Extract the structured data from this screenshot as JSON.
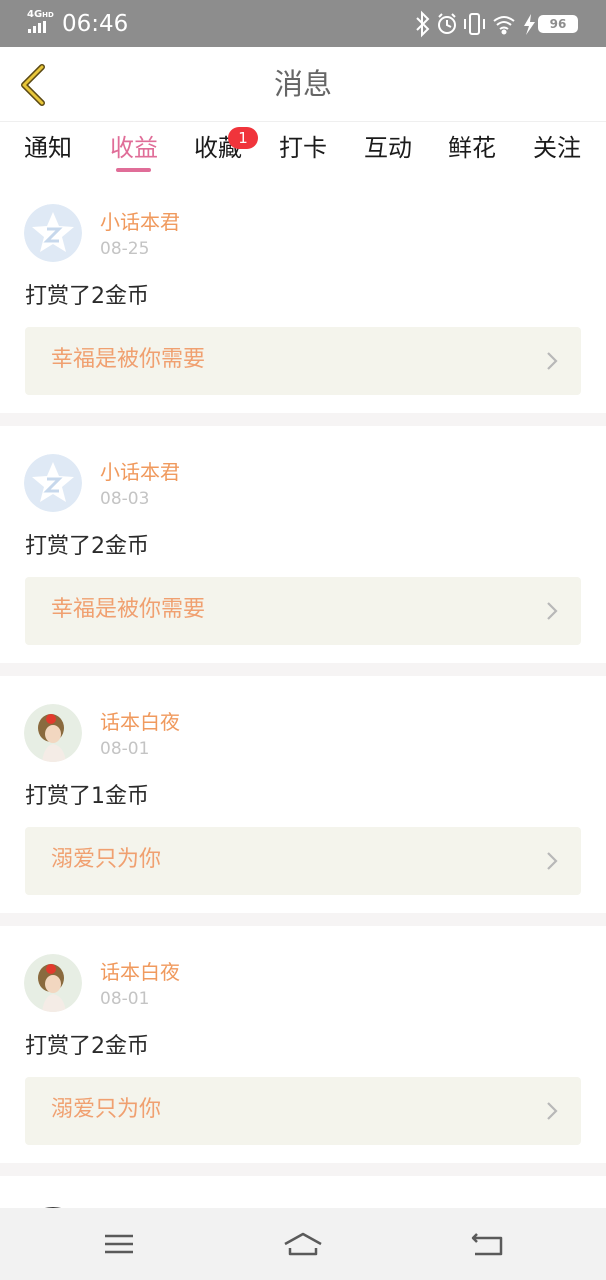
{
  "status_bar": {
    "network": "4G",
    "network_sup": "HD",
    "time": "06:46",
    "battery": "96",
    "icons": [
      "bluetooth-icon",
      "alarm-icon",
      "vibrate-icon",
      "wifi-icon",
      "charging-icon"
    ]
  },
  "header": {
    "title": "消息"
  },
  "tabs": [
    {
      "label": "通知"
    },
    {
      "label": "收益",
      "active": true
    },
    {
      "label": "收藏",
      "badge": "1"
    },
    {
      "label": "打卡"
    },
    {
      "label": "互动"
    },
    {
      "label": "鲜花"
    },
    {
      "label": "关注"
    }
  ],
  "messages": [
    {
      "name": "小话本君",
      "date": "08-25",
      "text": "打赏了2金币",
      "link": "幸福是被你需要",
      "avatar": "star-logo"
    },
    {
      "name": "小话本君",
      "date": "08-03",
      "text": "打赏了2金币",
      "link": "幸福是被你需要",
      "avatar": "star-logo"
    },
    {
      "name": "话本白夜",
      "date": "08-01",
      "text": "打赏了1金币",
      "link": "溺爱只为你",
      "avatar": "girl-photo"
    },
    {
      "name": "话本白夜",
      "date": "08-01",
      "text": "打赏了2金币",
      "link": "溺爱只为你",
      "avatar": "girl-photo"
    }
  ],
  "colors": {
    "accent": "#e06d98",
    "name": "#f09a5e",
    "link_text": "#f0a070",
    "link_bg": "#f4f4ec",
    "badge": "#f0343b",
    "status_bar": "#8d8d8d"
  }
}
